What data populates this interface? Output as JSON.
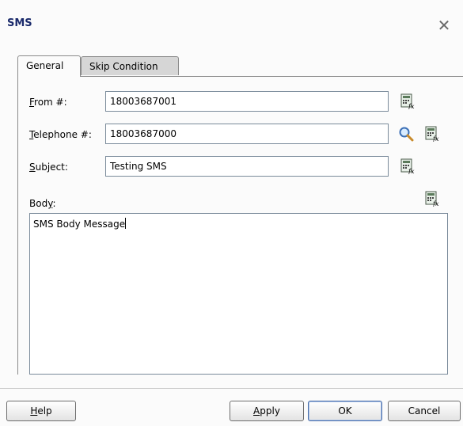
{
  "dialog": {
    "title": "SMS"
  },
  "tabs": [
    {
      "label": "General",
      "active": true
    },
    {
      "label": "Skip Condition",
      "active": false
    }
  ],
  "fields": {
    "from": {
      "label_mnemonic": "F",
      "label_rest": "rom #:",
      "value": "18003687001"
    },
    "telephone": {
      "label_mnemonic": "T",
      "label_rest": "elephone #:",
      "value": "18003687000"
    },
    "subject": {
      "label_mnemonic": "S",
      "label_rest": "ubject:",
      "value": "Testing SMS"
    },
    "body": {
      "label_pre": "Bod",
      "label_mnemonic": "y",
      "label_post": ":",
      "value": "SMS Body Message"
    }
  },
  "buttons": {
    "help": {
      "mnemonic": "H",
      "rest": "elp"
    },
    "apply": {
      "mnemonic": "A",
      "rest": "pply"
    },
    "ok": {
      "label": "OK"
    },
    "cancel": {
      "label": "Cancel"
    }
  },
  "icons": {
    "expression": "expression-builder-icon",
    "search": "search-icon",
    "close": "close-icon"
  }
}
